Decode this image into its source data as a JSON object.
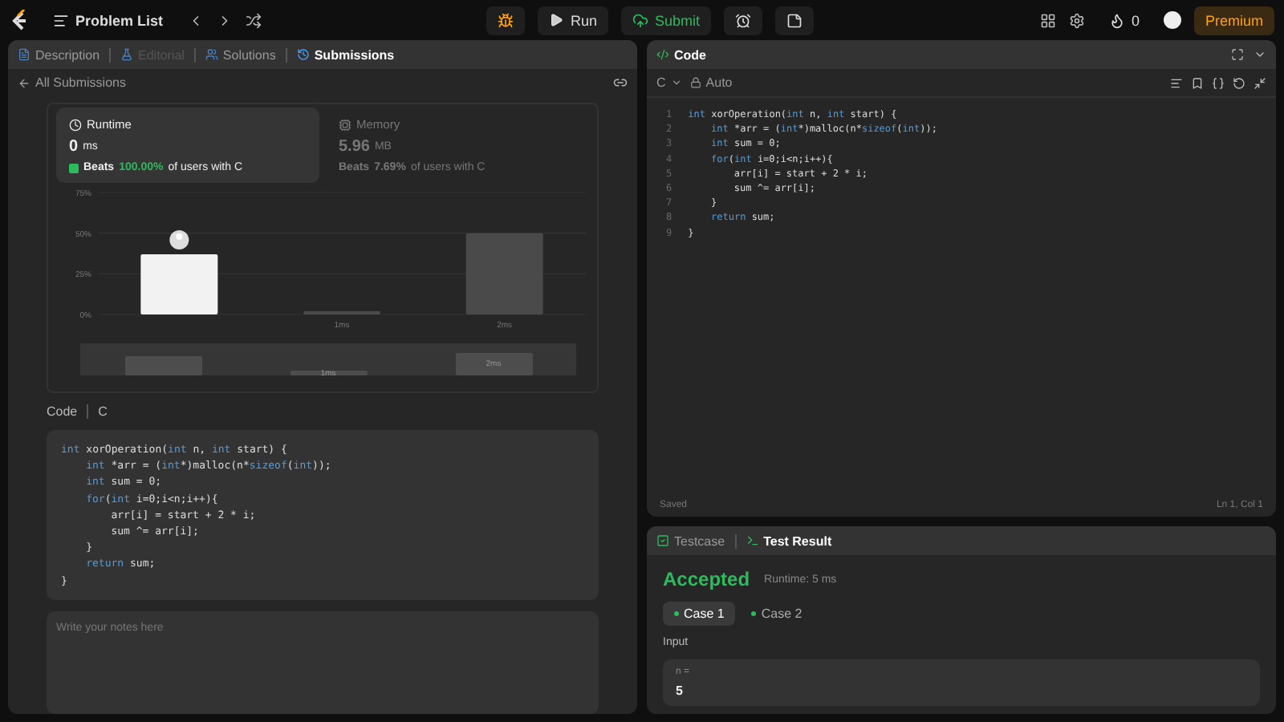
{
  "topbar": {
    "problem_list": "Problem List",
    "run": "Run",
    "submit": "Submit",
    "streak": "0",
    "premium": "Premium"
  },
  "left": {
    "tabs": [
      {
        "label": "Description",
        "selected": false,
        "disabled": false
      },
      {
        "label": "Editorial",
        "selected": false,
        "disabled": true
      },
      {
        "label": "Solutions",
        "selected": false,
        "disabled": false
      },
      {
        "label": "Submissions",
        "selected": true,
        "disabled": false
      }
    ],
    "back": "All Submissions",
    "stats": [
      {
        "title": "Runtime",
        "value": "0",
        "unit": "ms",
        "beats_pre": "Beats",
        "beats_pct": "100.00%",
        "beats_post": "of users with C",
        "selected": true
      },
      {
        "title": "Memory",
        "value": "5.96",
        "unit": "MB",
        "beats_pre": "Beats",
        "beats_pct": "7.69%",
        "beats_post": "of users with C",
        "selected": false
      }
    ],
    "chart_data": {
      "type": "bar",
      "categories": [
        null,
        "1ms",
        "2ms"
      ],
      "values": [
        0.37,
        0.02,
        0.5
      ],
      "ylim": [
        0,
        0.75
      ],
      "yticks": [
        {
          "value": 0,
          "label": "0%"
        },
        {
          "value": 0.25,
          "label": "25%"
        },
        {
          "value": 0.5,
          "label": "50%"
        },
        {
          "value": 0.75,
          "label": "75%"
        }
      ]
    },
    "overview_labels": [
      "1ms",
      "2ms"
    ],
    "code_label": "Code",
    "code_lang": "C",
    "code": [
      {
        "tokens": [
          {
            "kind": "keyword",
            "text": "int"
          },
          {
            "kind": "plain",
            "text": " xorOperation("
          },
          {
            "kind": "keyword",
            "text": "int"
          },
          {
            "kind": "plain",
            "text": " n, "
          },
          {
            "kind": "keyword",
            "text": "int"
          },
          {
            "kind": "plain",
            "text": " start) {"
          }
        ],
        "children": [
          {
            "tokens": [
              {
                "kind": "keyword",
                "text": "int"
              },
              {
                "kind": "plain",
                "text": " *arr = ("
              },
              {
                "kind": "keyword",
                "text": "int"
              },
              {
                "kind": "plain",
                "text": "*)malloc(n*"
              },
              {
                "kind": "keyword",
                "text": "sizeof"
              },
              {
                "kind": "plain",
                "text": "("
              },
              {
                "kind": "keyword",
                "text": "int"
              },
              {
                "kind": "plain",
                "text": "));"
              }
            ]
          },
          {
            "tokens": [
              {
                "kind": "keyword",
                "text": "int"
              },
              {
                "kind": "plain",
                "text": " sum = 0;"
              }
            ]
          },
          {
            "tokens": [
              {
                "kind": "keyword",
                "text": "for"
              },
              {
                "kind": "plain",
                "text": "("
              },
              {
                "kind": "keyword",
                "text": "int"
              },
              {
                "kind": "plain",
                "text": " i=0;i<n;i++){"
              }
            ],
            "children": [
              {
                "tokens": [
                  {
                    "kind": "plain",
                    "text": "arr[i] = start + 2 * i;"
                  }
                ]
              },
              {
                "tokens": [
                  {
                    "kind": "plain",
                    "text": "sum ^= arr[i];"
                  }
                ]
              }
            ]
          },
          {
            "tokens": [
              {
                "kind": "plain",
                "text": "}"
              }
            ]
          },
          {
            "tokens": [
              {
                "kind": "keyword",
                "text": "return"
              },
              {
                "kind": "plain",
                "text": " sum;"
              }
            ]
          }
        ]
      },
      {
        "tokens": [
          {
            "kind": "plain",
            "text": "}"
          }
        ]
      }
    ],
    "notes": {
      "placeholder": "Write your notes here"
    }
  },
  "editor": {
    "title": "Code",
    "language": "C",
    "mode": "Auto",
    "line_numbers": [
      "1",
      "2",
      "3",
      "4",
      "5",
      "6",
      "7",
      "8",
      "9"
    ],
    "code": [
      {
        "tokens": [
          {
            "kind": "keyword",
            "text": "int"
          },
          {
            "kind": "plain",
            "text": " xorOperation("
          },
          {
            "kind": "keyword",
            "text": "int"
          },
          {
            "kind": "plain",
            "text": " n, "
          },
          {
            "kind": "keyword",
            "text": "int"
          },
          {
            "kind": "plain",
            "text": " start) {"
          }
        ],
        "children": [
          {
            "tokens": [
              {
                "kind": "keyword",
                "text": "int"
              },
              {
                "kind": "plain",
                "text": " *arr = ("
              },
              {
                "kind": "keyword",
                "text": "int"
              },
              {
                "kind": "plain",
                "text": "*)malloc(n*"
              },
              {
                "kind": "keyword",
                "text": "sizeof"
              },
              {
                "kind": "plain",
                "text": "("
              },
              {
                "kind": "keyword",
                "text": "int"
              },
              {
                "kind": "plain",
                "text": "));"
              }
            ]
          },
          {
            "tokens": [
              {
                "kind": "keyword",
                "text": "int"
              },
              {
                "kind": "plain",
                "text": " sum = 0;"
              }
            ]
          },
          {
            "tokens": [
              {
                "kind": "keyword",
                "text": "for"
              },
              {
                "kind": "plain",
                "text": "("
              },
              {
                "kind": "keyword",
                "text": "int"
              },
              {
                "kind": "plain",
                "text": " i=0;i<n;i++){"
              }
            ],
            "children": [
              {
                "tokens": [
                  {
                    "kind": "plain",
                    "text": "arr[i] = start + 2 * i;"
                  }
                ]
              },
              {
                "tokens": [
                  {
                    "kind": "plain",
                    "text": "sum ^= arr[i];"
                  }
                ]
              }
            ]
          },
          {
            "tokens": [
              {
                "kind": "plain",
                "text": "}"
              }
            ]
          },
          {
            "tokens": [
              {
                "kind": "keyword",
                "text": "return"
              },
              {
                "kind": "plain",
                "text": " sum;"
              }
            ]
          }
        ]
      },
      {
        "tokens": [
          {
            "kind": "plain",
            "text": "}"
          }
        ]
      }
    ],
    "status": "Saved",
    "cursor": "Ln 1, Col 1"
  },
  "result": {
    "tabs": [
      {
        "label": "Testcase",
        "selected": false
      },
      {
        "label": "Test Result",
        "selected": true
      }
    ],
    "verdict": "Accepted",
    "runtime": "Runtime: 5 ms",
    "cases": [
      {
        "label": "Case 1",
        "selected": true
      },
      {
        "label": "Case 2",
        "selected": false
      }
    ],
    "input_label": "Input",
    "param": "n =",
    "value": "5"
  }
}
